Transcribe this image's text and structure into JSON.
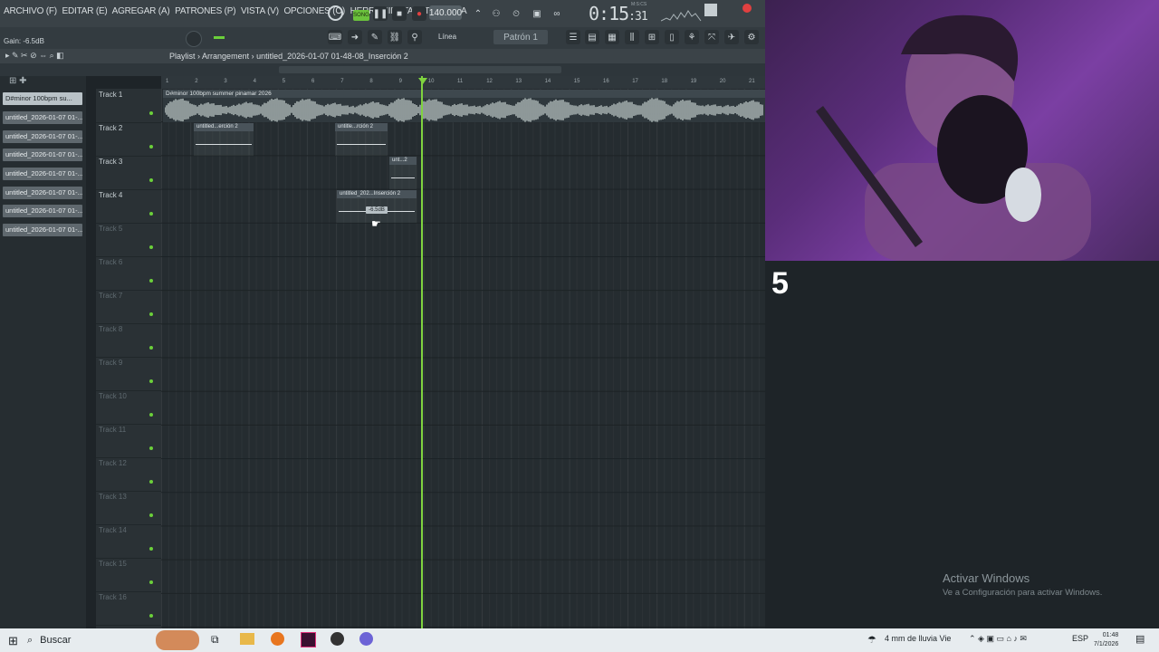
{
  "menu": {
    "items": [
      "ARCHIVO (F)",
      "EDITAR (E)",
      "AGREGAR (A)",
      "PATRONES (P)",
      "VISTA (V)",
      "OPCIONES (O)",
      "HERRAMIENTAS (T)",
      "AYUDA"
    ],
    "song_label": "SONG",
    "tempo": "140.000",
    "time_main": "0:15",
    "time_sub": ":31",
    "time_caption": "M:S:CS"
  },
  "toolbar": {
    "gain": "Gain: -6.5dB",
    "snap": "Línea",
    "pattern": "Patrón 1"
  },
  "playlist": {
    "title": "Playlist",
    "separator": "›",
    "arrangement": "Arrangement",
    "project": "untitled_2026-01-07 01-48-08_Inserción 2"
  },
  "picker": {
    "items": [
      "D#minor 100bpm su...",
      "untitled_2026-01-07 01-...",
      "untitled_2026-01-07 01-...",
      "untitled_2026-01-07 01-...",
      "untitled_2026-01-07 01-...",
      "untitled_2026-01-07 01-...",
      "untitled_2026-01-07 01-...",
      "untitled_2026-01-07 01-..."
    ]
  },
  "tracks": [
    "Track 1",
    "Track 2",
    "Track 3",
    "Track 4",
    "Track 5",
    "Track 6",
    "Track 7",
    "Track 8",
    "Track 9",
    "Track 10",
    "Track 11",
    "Track 12",
    "Track 13",
    "Track 14",
    "Track 15",
    "Track 16"
  ],
  "ruler": [
    "1",
    "2",
    "3",
    "4",
    "5",
    "6",
    "7",
    "8",
    "9",
    "10",
    "11",
    "12",
    "13",
    "14",
    "15",
    "16",
    "17",
    "18",
    "19",
    "20",
    "21"
  ],
  "clips": {
    "audio_main": "D#minor 100bpm summer pinamar 2026",
    "c1": "untitled...erción 2",
    "c2": "untitle...rción 2",
    "c3": "unt...2",
    "c4": "untitled_202...Inserción 2",
    "volume_tip": "-6.5dB"
  },
  "overlay": {
    "count": "5",
    "activate_title": "Activar Windows",
    "activate_sub": "Ve a Configuración para activar Windows."
  },
  "taskbar": {
    "search": "Buscar",
    "weather": "4 mm de lluvia Vie",
    "lang": "ESP",
    "clock_time": "01:48",
    "clock_date": "7/1/2026"
  },
  "colors": {
    "accent_green": "#7fd33f",
    "background": "#1e2428",
    "webcam_purple": "#5a2d7a"
  }
}
